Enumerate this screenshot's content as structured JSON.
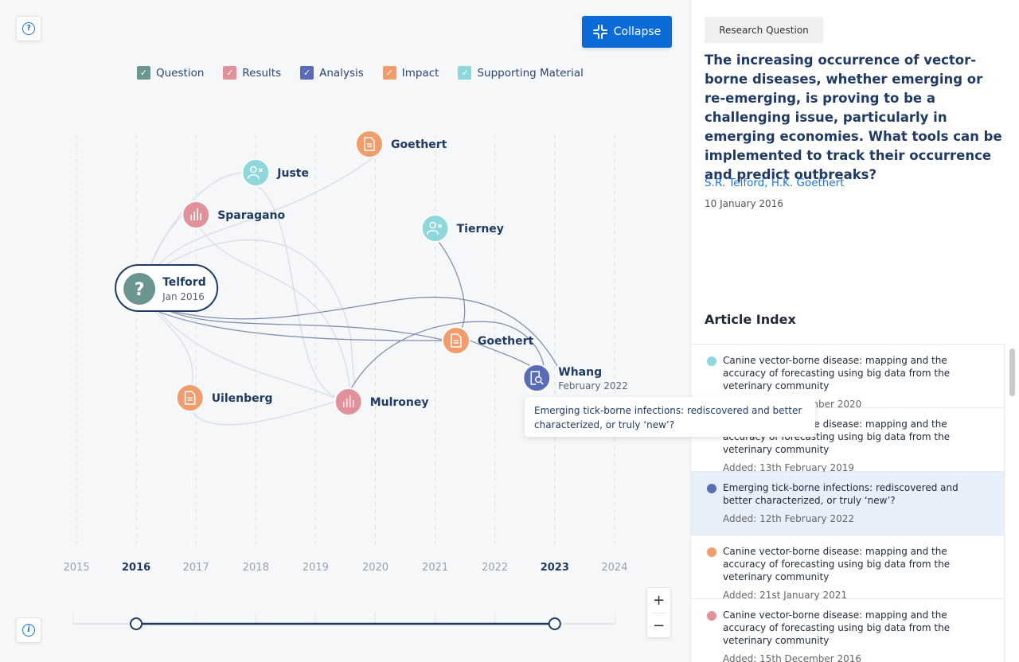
{
  "toolbar": {
    "help_icon": "question-circle-icon",
    "info_icon": "info-circle-icon",
    "collapse_label": "Collapse",
    "collapse_icon": "collapse-arrows-icon"
  },
  "legend": [
    {
      "label": "Question",
      "color": "#6b9590",
      "checked": true
    },
    {
      "label": "Results",
      "color": "#e0919a",
      "checked": true
    },
    {
      "label": "Analysis",
      "color": "#5a6cb8",
      "checked": true
    },
    {
      "label": "Impact",
      "color": "#f29c6b",
      "checked": true
    },
    {
      "label": "Supporting Material",
      "color": "#8ed8dc",
      "checked": true
    }
  ],
  "graph": {
    "axis_years": [
      "2015",
      "2016",
      "2017",
      "2018",
      "2019",
      "2020",
      "2021",
      "2022",
      "2023",
      "2024"
    ],
    "highlighted_years": [
      "2016",
      "2023"
    ],
    "range": {
      "start": "2016",
      "end": "2023"
    },
    "nodes": [
      {
        "id": "telford",
        "label": "Telford",
        "sub": "Jan 2016",
        "type": "Question",
        "icon": "question-mark-icon",
        "year": 2016.0,
        "selected": true
      },
      {
        "id": "juste",
        "label": "Juste",
        "type": "Supporting Material",
        "icon": "user-remove-icon",
        "year": 2018.0
      },
      {
        "id": "sparagano",
        "label": "Sparagano",
        "type": "Results",
        "icon": "bar-chart-icon",
        "year": 2017.0
      },
      {
        "id": "goethert1",
        "label": "Goethert",
        "type": "Impact",
        "icon": "document-icon",
        "year": 2019.9
      },
      {
        "id": "tierney",
        "label": "Tierney",
        "type": "Supporting Material",
        "icon": "user-remove-icon",
        "year": 2021.0
      },
      {
        "id": "goethert2",
        "label": "Goethert",
        "type": "Impact",
        "icon": "document-icon",
        "year": 2021.35
      },
      {
        "id": "whang",
        "label": "Whang",
        "sub": "February 2022",
        "type": "Analysis",
        "icon": "document-search-icon",
        "year": 2022.7
      },
      {
        "id": "uilenberg",
        "label": "Uilenberg",
        "type": "Impact",
        "icon": "document-icon",
        "year": 2016.9
      },
      {
        "id": "mulroney",
        "label": "Mulroney",
        "type": "Results",
        "icon": "bar-chart-icon",
        "year": 2019.55
      }
    ],
    "tooltip": "Emerging tick-borne infections: rediscovered and better characterized, or truly ‘new’?"
  },
  "zoom": {
    "in_label": "+",
    "out_label": "−"
  },
  "research": {
    "tag": "Research Question",
    "question": "The increasing occurrence of vector-borne diseases, whether emerging or re-emerging, is proving to be a challenging issue, particularly in emerging economies. What tools can be implemented to track their occurrence and predict outbreaks?",
    "authors": "S.R. Telford, H.K. Goethert",
    "date": "10 January 2016"
  },
  "article_index": {
    "title": "Article Index",
    "items": [
      {
        "title": "Canine vector-borne disease: mapping and the accuracy of forecasting using big data from the veterinary community",
        "added": "Added: 26th November 2020",
        "color": "#8ed8dc",
        "active": false
      },
      {
        "title": "Canine vector-borne disease: mapping and the accuracy of forecasting using big data from the veterinary community",
        "added": "Added: 13th February 2019",
        "color": "#e0919a",
        "active": false
      },
      {
        "title": "Emerging tick-borne infections: rediscovered and better characterized, or truly ‘new’?",
        "added": "Added: 12th February 2022",
        "color": "#5a6cb8",
        "active": true
      },
      {
        "title": "Canine vector-borne disease: mapping and the accuracy of forecasting using big data from the veterinary community",
        "added": "Added: 21st January 2021",
        "color": "#f29c6b",
        "active": false
      },
      {
        "title": "Canine vector-borne disease: mapping and the accuracy of forecasting using big data from the veterinary community",
        "added": "Added: 15th December 2016",
        "color": "#e0919a",
        "active": false
      }
    ]
  }
}
